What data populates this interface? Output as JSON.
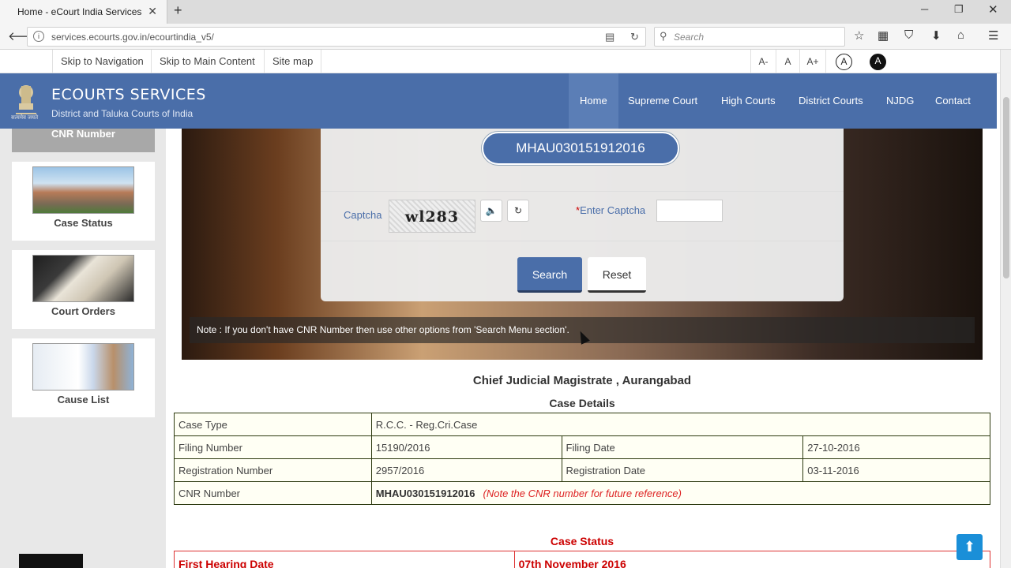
{
  "browser": {
    "tab_title": "Home - eCourt India Services",
    "url": "services.ecourts.gov.in/ecourtindia_v5/",
    "search_placeholder": "Search"
  },
  "access_bar": {
    "skip_nav": "Skip to Navigation",
    "skip_main": "Skip to Main Content",
    "site_map": "Site map",
    "font_smaller": "A-",
    "font_normal": "A",
    "font_larger": "A+",
    "contrast_light": "A",
    "contrast_dark": "A"
  },
  "header": {
    "title": "ECOURTS SERVICES",
    "subtitle": "District and Taluka Courts of India",
    "emblem_caption": "सत्यमेव जयते",
    "menu": [
      "Home",
      "Supreme Court",
      "High Courts",
      "District Courts",
      "NJDG",
      "Contact Us"
    ]
  },
  "sidebar": {
    "active_tab": "CNR Number",
    "cards": [
      "Case Status",
      "Court Orders",
      "Cause List"
    ]
  },
  "search_panel": {
    "cnr_value": "MHAU030151912016",
    "captcha_label": "Captcha",
    "captcha_text": "wl283",
    "enter_captcha_required": "*",
    "enter_captcha_label": "Enter Captcha",
    "search_button": "Search",
    "reset_button": "Reset",
    "note": "Note : If you don't have CNR Number then use other options from 'Search Menu section'."
  },
  "court_name": "Chief Judicial Magistrate , Aurangabad",
  "case_details": {
    "heading": "Case Details",
    "case_type_label": "Case Type",
    "case_type_value": "R.C.C. - Reg.Cri.Case",
    "filing_number_label": "Filing Number",
    "filing_number_value": "15190/2016",
    "filing_date_label": "Filing Date",
    "filing_date_value": "27-10-2016",
    "registration_number_label": "Registration Number",
    "registration_number_value": "2957/2016",
    "registration_date_label": "Registration Date",
    "registration_date_value": "03-11-2016",
    "cnr_label": "CNR Number",
    "cnr_value": "MHAU030151912016",
    "cnr_note": "(Note the CNR number for future reference)"
  },
  "case_status": {
    "heading": "Case Status",
    "first_hearing_label": "First Hearing Date",
    "first_hearing_value": "07th November 2016"
  }
}
